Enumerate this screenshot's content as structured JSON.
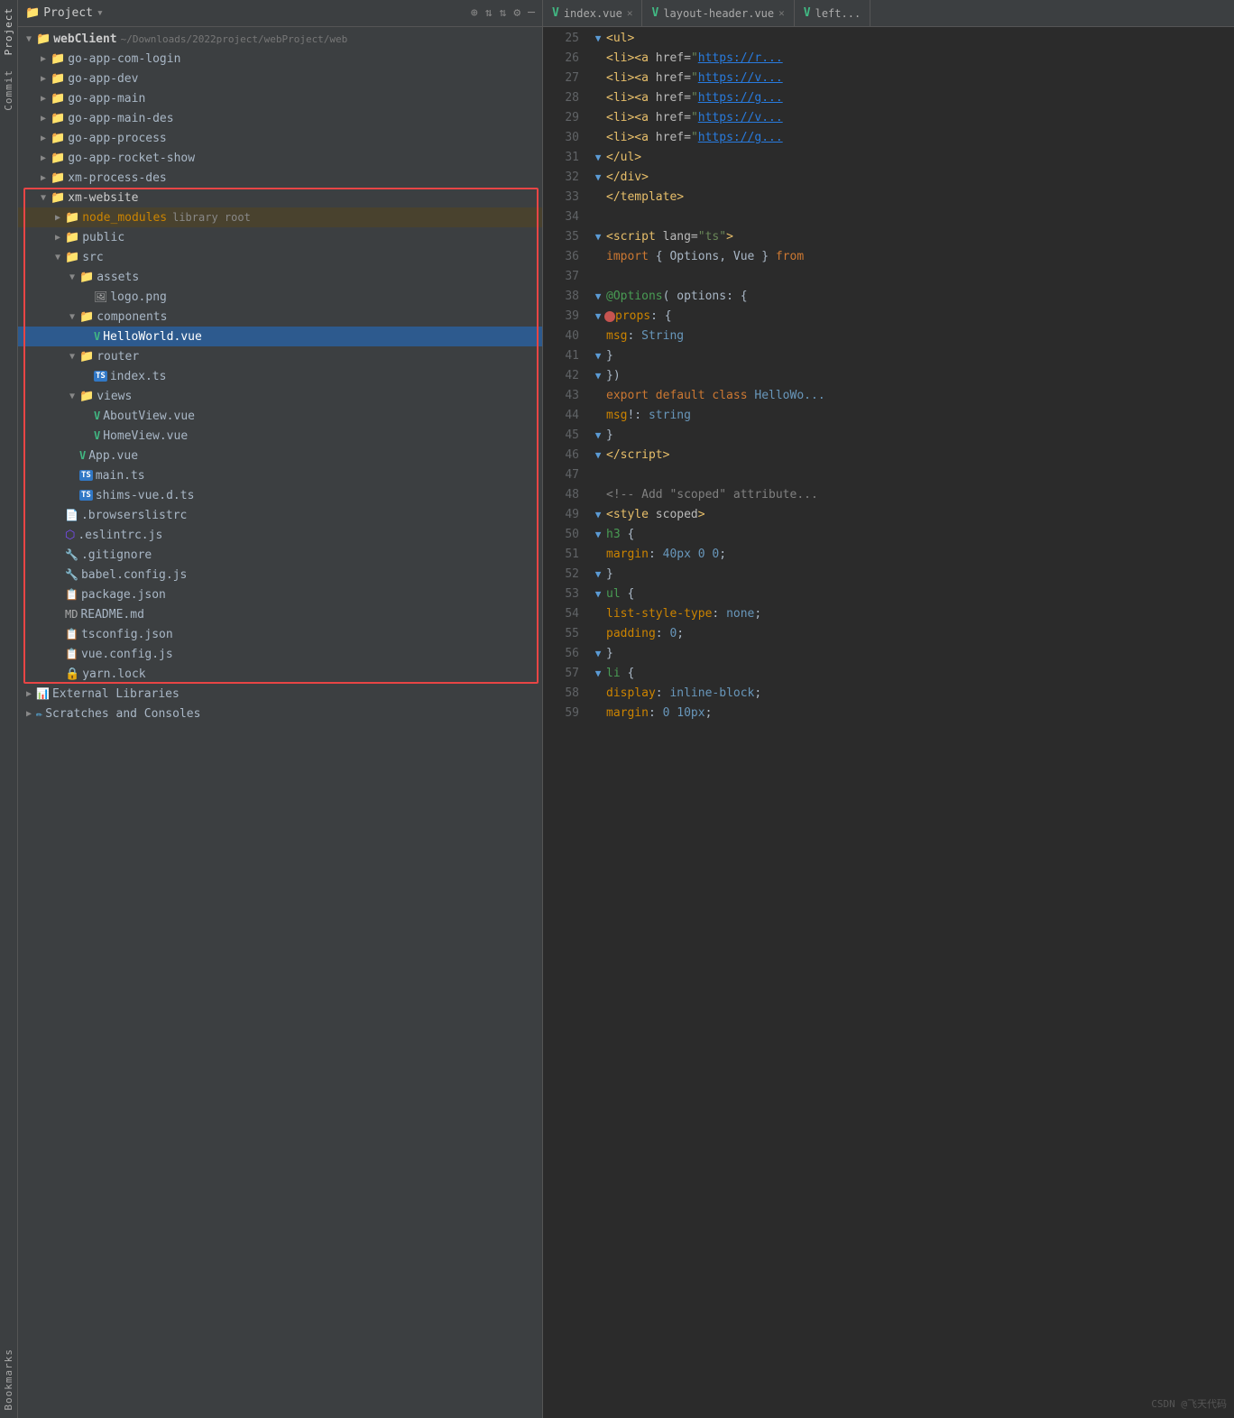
{
  "sidebar": {
    "labels": [
      "Project",
      "Commit",
      ""
    ]
  },
  "panel_header": {
    "title": "Project",
    "dropdown_icon": "▾",
    "actions": [
      "⊕",
      "⇅",
      "⇅",
      "⚙",
      "─"
    ]
  },
  "file_tree": {
    "root": "webClient",
    "root_path": "~/Downloads/2022project/webProject/web",
    "items": [
      {
        "id": 1,
        "level": 1,
        "type": "folder",
        "expanded": false,
        "name": "go-app-com-login",
        "color": "normal"
      },
      {
        "id": 2,
        "level": 1,
        "type": "folder",
        "expanded": false,
        "name": "go-app-dev",
        "color": "normal"
      },
      {
        "id": 3,
        "level": 1,
        "type": "folder",
        "expanded": false,
        "name": "go-app-main",
        "color": "normal"
      },
      {
        "id": 4,
        "level": 1,
        "type": "folder",
        "expanded": false,
        "name": "go-app-main-des",
        "color": "normal"
      },
      {
        "id": 5,
        "level": 1,
        "type": "folder",
        "expanded": false,
        "name": "go-app-process",
        "color": "normal"
      },
      {
        "id": 6,
        "level": 1,
        "type": "folder",
        "expanded": false,
        "name": "go-app-rocket-show",
        "color": "normal"
      },
      {
        "id": 7,
        "level": 1,
        "type": "folder",
        "expanded": false,
        "name": "xm-process-des",
        "color": "normal"
      },
      {
        "id": 8,
        "level": 1,
        "type": "folder",
        "expanded": true,
        "name": "xm-website",
        "color": "normal",
        "outline": true
      },
      {
        "id": 9,
        "level": 2,
        "type": "folder",
        "expanded": false,
        "name": "node_modules",
        "extra": "library root",
        "color": "orange",
        "highlighted": true
      },
      {
        "id": 10,
        "level": 2,
        "type": "folder",
        "expanded": false,
        "name": "public",
        "color": "normal"
      },
      {
        "id": 11,
        "level": 2,
        "type": "folder",
        "expanded": true,
        "name": "src",
        "color": "normal"
      },
      {
        "id": 12,
        "level": 3,
        "type": "folder",
        "expanded": true,
        "name": "assets",
        "color": "normal"
      },
      {
        "id": 13,
        "level": 4,
        "type": "file",
        "name": "logo.png",
        "icon": "img",
        "color": "normal"
      },
      {
        "id": 14,
        "level": 3,
        "type": "folder",
        "expanded": true,
        "name": "components",
        "color": "normal"
      },
      {
        "id": 15,
        "level": 4,
        "type": "file",
        "name": "HelloWorld.vue",
        "icon": "vue",
        "color": "green",
        "selected": true
      },
      {
        "id": 16,
        "level": 3,
        "type": "folder",
        "expanded": true,
        "name": "router",
        "color": "normal"
      },
      {
        "id": 17,
        "level": 4,
        "type": "file",
        "name": "index.ts",
        "icon": "ts",
        "color": "normal"
      },
      {
        "id": 18,
        "level": 3,
        "type": "folder",
        "expanded": true,
        "name": "views",
        "color": "normal"
      },
      {
        "id": 19,
        "level": 4,
        "type": "file",
        "name": "AboutView.vue",
        "icon": "vue",
        "color": "green"
      },
      {
        "id": 20,
        "level": 4,
        "type": "file",
        "name": "HomeView.vue",
        "icon": "vue",
        "color": "green"
      },
      {
        "id": 21,
        "level": 3,
        "type": "file",
        "name": "App.vue",
        "icon": "vue",
        "color": "green"
      },
      {
        "id": 22,
        "level": 3,
        "type": "file",
        "name": "main.ts",
        "icon": "ts",
        "color": "normal"
      },
      {
        "id": 23,
        "level": 3,
        "type": "file",
        "name": "shims-vue.d.ts",
        "icon": "ts",
        "color": "normal"
      },
      {
        "id": 24,
        "level": 2,
        "type": "file",
        "name": ".browserslistrc",
        "icon": "text",
        "color": "normal"
      },
      {
        "id": 25,
        "level": 2,
        "type": "file",
        "name": ".eslintrc.js",
        "icon": "eslint",
        "color": "normal"
      },
      {
        "id": 26,
        "level": 2,
        "type": "file",
        "name": ".gitignore",
        "icon": "git",
        "color": "normal"
      },
      {
        "id": 27,
        "level": 2,
        "type": "file",
        "name": "babel.config.js",
        "icon": "babel",
        "color": "normal"
      },
      {
        "id": 28,
        "level": 2,
        "type": "file",
        "name": "package.json",
        "icon": "json",
        "color": "normal"
      },
      {
        "id": 29,
        "level": 2,
        "type": "file",
        "name": "README.md",
        "icon": "md",
        "color": "normal"
      },
      {
        "id": 30,
        "level": 2,
        "type": "file",
        "name": "tsconfig.json",
        "icon": "json",
        "color": "normal"
      },
      {
        "id": 31,
        "level": 2,
        "type": "file",
        "name": "vue.config.js",
        "icon": "js",
        "color": "normal"
      },
      {
        "id": 32,
        "level": 2,
        "type": "file",
        "name": "yarn.lock",
        "icon": "yarn",
        "color": "normal"
      },
      {
        "id": 33,
        "level": 1,
        "type": "special",
        "name": "External Libraries",
        "icon": "ext"
      },
      {
        "id": 34,
        "level": 1,
        "type": "special",
        "name": "Scratches and Consoles",
        "icon": "scratch"
      }
    ]
  },
  "editor": {
    "tabs": [
      {
        "label": "index.vue",
        "icon": "vue",
        "active": false
      },
      {
        "label": "layout-header.vue",
        "icon": "vue",
        "active": false
      },
      {
        "label": "left...",
        "icon": "vue",
        "active": false
      }
    ],
    "lines": [
      {
        "num": 25,
        "fold": true,
        "content": "<span class='c-tag'>&lt;ul&gt;</span>",
        "gutter_fold": "▼"
      },
      {
        "num": 26,
        "fold": false,
        "content": "<span class='c-tag'>&lt;li&gt;&lt;a</span> <span class='c-attr'>href=</span><span class='c-string'>\"https://r...</span>",
        "gutter_fold": ""
      },
      {
        "num": 27,
        "fold": false,
        "content": "<span class='c-tag'>&lt;li&gt;&lt;a</span> <span class='c-attr'>href=</span><span class='c-string'>\"https://v...</span>",
        "gutter_fold": ""
      },
      {
        "num": 28,
        "fold": false,
        "content": "<span class='c-tag'>&lt;li&gt;&lt;a</span> <span class='c-attr'>href=</span><span class='c-string'>\"https://g...</span>",
        "gutter_fold": ""
      },
      {
        "num": 29,
        "fold": false,
        "content": "<span class='c-tag'>&lt;li&gt;&lt;a</span> <span class='c-attr'>href=</span><span class='c-string'>\"https://v...</span>",
        "gutter_fold": ""
      },
      {
        "num": 30,
        "fold": false,
        "content": "<span class='c-tag'>&lt;li&gt;&lt;a</span> <span class='c-attr'>href=</span><span class='c-string'>\"https://g...</span>",
        "gutter_fold": ""
      },
      {
        "num": 31,
        "fold": true,
        "content": "    <span class='c-tag'>&lt;/ul&gt;</span>",
        "gutter_fold": "▼"
      },
      {
        "num": 32,
        "fold": true,
        "content": "  <span class='c-tag'>&lt;/div&gt;</span>",
        "gutter_fold": "▼"
      },
      {
        "num": 33,
        "fold": false,
        "content": "<span class='c-tag'>&lt;/template&gt;</span>",
        "gutter_fold": ""
      },
      {
        "num": 34,
        "fold": false,
        "content": "",
        "gutter_fold": ""
      },
      {
        "num": 35,
        "fold": true,
        "content": "<span class='c-tag'>&lt;script</span> <span class='c-attr'>lang=</span><span class='c-string'>\"ts\"</span><span class='c-tag'>&gt;</span>",
        "gutter_fold": "▼"
      },
      {
        "num": 36,
        "fold": false,
        "content": "  <span class='c-keyword'>import</span> <span class='c-punct'>{ Options, Vue }</span> <span class='c-keyword'>from</span>",
        "gutter_fold": ""
      },
      {
        "num": 37,
        "fold": false,
        "content": "",
        "gutter_fold": ""
      },
      {
        "num": 38,
        "fold": true,
        "content": "<span class='c-green'>@Options</span><span class='c-punct'>( </span><span class='c-plain'>options: </span><span class='c-punct'>{</span>",
        "gutter_fold": "▼"
      },
      {
        "num": 39,
        "fold": true,
        "content": "  <span class='c-orange'>props</span><span class='c-punct'>: {</span>",
        "gutter_fold": "▼",
        "breakpoint": true
      },
      {
        "num": 40,
        "fold": false,
        "content": "    <span class='c-orange'>msg</span><span class='c-punct'>:</span> <span class='c-type'>String</span>",
        "gutter_fold": ""
      },
      {
        "num": 41,
        "fold": true,
        "content": "  <span class='c-punct'>}</span>",
        "gutter_fold": "▼"
      },
      {
        "num": 42,
        "fold": true,
        "content": "<span class='c-punct'>})</span>",
        "gutter_fold": "▼"
      },
      {
        "num": 43,
        "fold": false,
        "content": "<span class='c-keyword'>export default class</span> <span class='c-type'>HelloWo...</span>",
        "gutter_fold": ""
      },
      {
        "num": 44,
        "fold": false,
        "content": "  <span class='c-orange'>msg</span><span class='c-punct'>!:</span> <span class='c-type'>string</span>",
        "gutter_fold": ""
      },
      {
        "num": 45,
        "fold": true,
        "content": "<span class='c-punct'>}</span>",
        "gutter_fold": "▼"
      },
      {
        "num": 46,
        "fold": true,
        "content": "<span class='c-tag'>&lt;/script&gt;</span>",
        "gutter_fold": "▼"
      },
      {
        "num": 47,
        "fold": false,
        "content": "",
        "gutter_fold": ""
      },
      {
        "num": 48,
        "fold": false,
        "content": "  <span class='c-comment'>&lt;!-- Add \"scoped\" attribute...</span>",
        "gutter_fold": ""
      },
      {
        "num": 49,
        "fold": true,
        "content": "<span class='c-tag'>&lt;style</span> <span class='c-attr'>scoped</span><span class='c-tag'>&gt;</span>",
        "gutter_fold": "▼"
      },
      {
        "num": 50,
        "fold": true,
        "content": "<span class='c-green'>h3</span> <span class='c-punct'>{</span>",
        "gutter_fold": "▼"
      },
      {
        "num": 51,
        "fold": false,
        "content": "  <span class='c-orange'>margin</span><span class='c-punct'>:</span> <span class='c-type'>40px 0 0</span><span class='c-punct'>;</span>",
        "gutter_fold": ""
      },
      {
        "num": 52,
        "fold": true,
        "content": "<span class='c-punct'>}</span>",
        "gutter_fold": "▼"
      },
      {
        "num": 53,
        "fold": true,
        "content": "<span class='c-green'>ul</span> <span class='c-punct'>{</span>",
        "gutter_fold": "▼"
      },
      {
        "num": 54,
        "fold": false,
        "content": "  <span class='c-orange'>list-style-type</span><span class='c-punct'>:</span> <span class='c-type'>none</span><span class='c-punct'>;</span>",
        "gutter_fold": ""
      },
      {
        "num": 55,
        "fold": false,
        "content": "  <span class='c-orange'>padding</span><span class='c-punct'>:</span> <span class='c-type'>0</span><span class='c-punct'>;</span>",
        "gutter_fold": ""
      },
      {
        "num": 56,
        "fold": true,
        "content": "<span class='c-punct'>}</span>",
        "gutter_fold": "▼"
      },
      {
        "num": 57,
        "fold": true,
        "content": "<span class='c-green'>li</span> <span class='c-punct'>{</span>",
        "gutter_fold": "▼"
      },
      {
        "num": 58,
        "fold": false,
        "content": "  <span class='c-orange'>display</span><span class='c-punct'>:</span> <span class='c-type'>inline-block</span><span class='c-punct'>;</span>",
        "gutter_fold": ""
      },
      {
        "num": 59,
        "fold": false,
        "content": "  <span class='c-orange'>margin</span><span class='c-punct'>:</span> <span class='c-type'>0 10px</span><span class='c-punct'>;</span>",
        "gutter_fold": ""
      }
    ]
  },
  "watermark": "CSDN @飞天代码"
}
